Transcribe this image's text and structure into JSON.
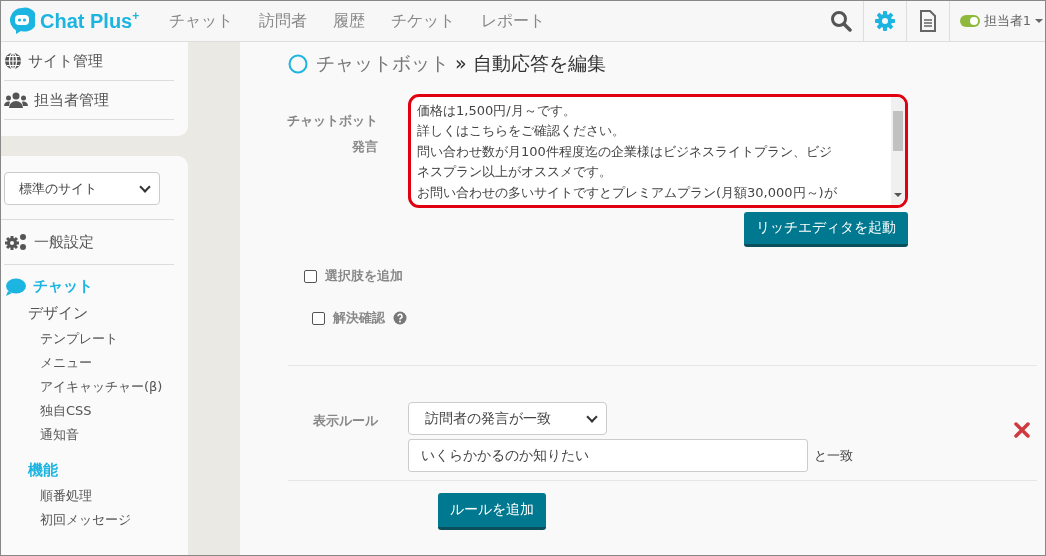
{
  "header": {
    "logo": "Chat Plus",
    "logo_mark": "+",
    "nav": [
      {
        "label": "チャット"
      },
      {
        "label": "訪問者"
      },
      {
        "label": "履歴"
      },
      {
        "label": "チケット"
      },
      {
        "label": "レポート"
      }
    ],
    "user": {
      "name": "担当者1",
      "online": true
    }
  },
  "sidebar": {
    "top_items": [
      {
        "label": "サイト管理"
      },
      {
        "label": "担当者管理"
      }
    ],
    "site_select": "標準のサイト",
    "general": {
      "label": "一般設定"
    },
    "section": {
      "label": "チャット",
      "selected": true
    },
    "groups": [
      {
        "label": "デザイン",
        "kind": "plain",
        "children": [
          {
            "label": "テンプレート"
          },
          {
            "label": "メニュー"
          },
          {
            "label": "アイキャッチャー(β)"
          },
          {
            "label": "独自CSS"
          },
          {
            "label": "通知音"
          }
        ]
      },
      {
        "label": "機能",
        "kind": "accent",
        "children": [
          {
            "label": "順番処理"
          },
          {
            "label": "初回メッセージ"
          }
        ]
      }
    ]
  },
  "page": {
    "title_parent": "チャットボット",
    "title_sep": "»",
    "title": "自動応答を編集",
    "message": {
      "label_1": "チャットボット",
      "label_2": "発言",
      "lines": [
        "価格は1,500円/月～です。",
        "詳しくはこちらをご確認ください。",
        "問い合わせ数が月100件程度迄の企業様はビジネスライトプラン、ビジ",
        "ネスプラン以上がオススメです。",
        "お問い合わせの多いサイトですとプレミアムプラン(月額30,000円～)が"
      ]
    },
    "rich_editor_button": "リッチエディタを起動",
    "options": [
      {
        "label": "選択肢を追加",
        "checked": false,
        "help": false
      },
      {
        "label": "解決確認",
        "checked": false,
        "help": true
      }
    ],
    "rule": {
      "label": "表示ルール",
      "condition": "訪問者の発言が一致",
      "value": "いくらかかるのか知りたい",
      "suffix": "と一致"
    },
    "add_rule_button": "ルールを追加"
  }
}
